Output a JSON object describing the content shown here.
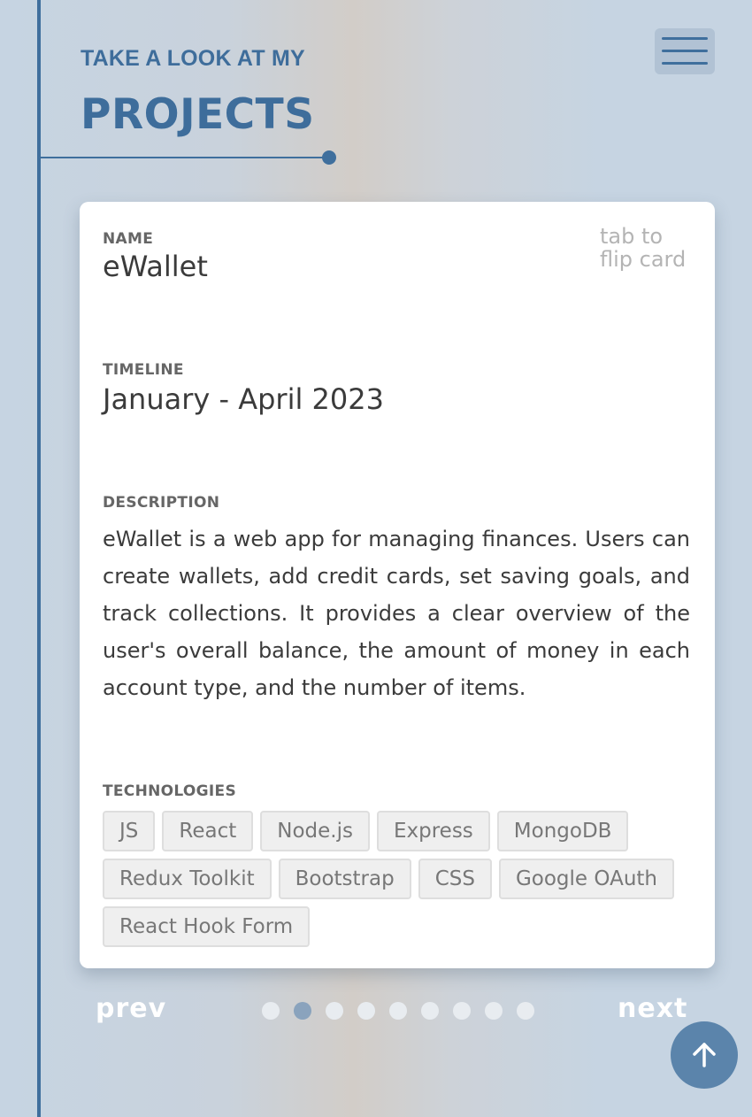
{
  "header": {
    "eyebrow": "TAKE A LOOK AT MY",
    "title": "PROJECTS"
  },
  "menu": {
    "icon": "hamburger-menu-icon"
  },
  "card": {
    "flip_hint": "tab to flip card",
    "name_label": "NAME",
    "name": "eWallet",
    "timeline_label": "TIMELINE",
    "timeline": "January - April 2023",
    "description_label": "DESCRIPTION",
    "description": "eWallet is a web app for managing finances. Users can create wallets, add credit cards, set saving goals, and track collections. It provides a clear overview of the user's overall balance, the amount of money in each account type, and the number of items.",
    "technologies_label": "TECHNOLOGIES",
    "technologies": [
      "JS",
      "React",
      "Node.js",
      "Express",
      "MongoDB",
      "Redux Toolkit",
      "Bootstrap",
      "CSS",
      "Google OAuth",
      "React Hook Form"
    ]
  },
  "pagination": {
    "prev_label": "prev",
    "next_label": "next",
    "total": 9,
    "active_index": 1
  },
  "scroll_top": {
    "icon": "arrow-up-icon"
  },
  "colors": {
    "accent": "#3e6d9b",
    "scroll_button": "#5b84ab",
    "dot_active": "#8aa3bd",
    "dot_inactive": "#e8ecf0"
  }
}
